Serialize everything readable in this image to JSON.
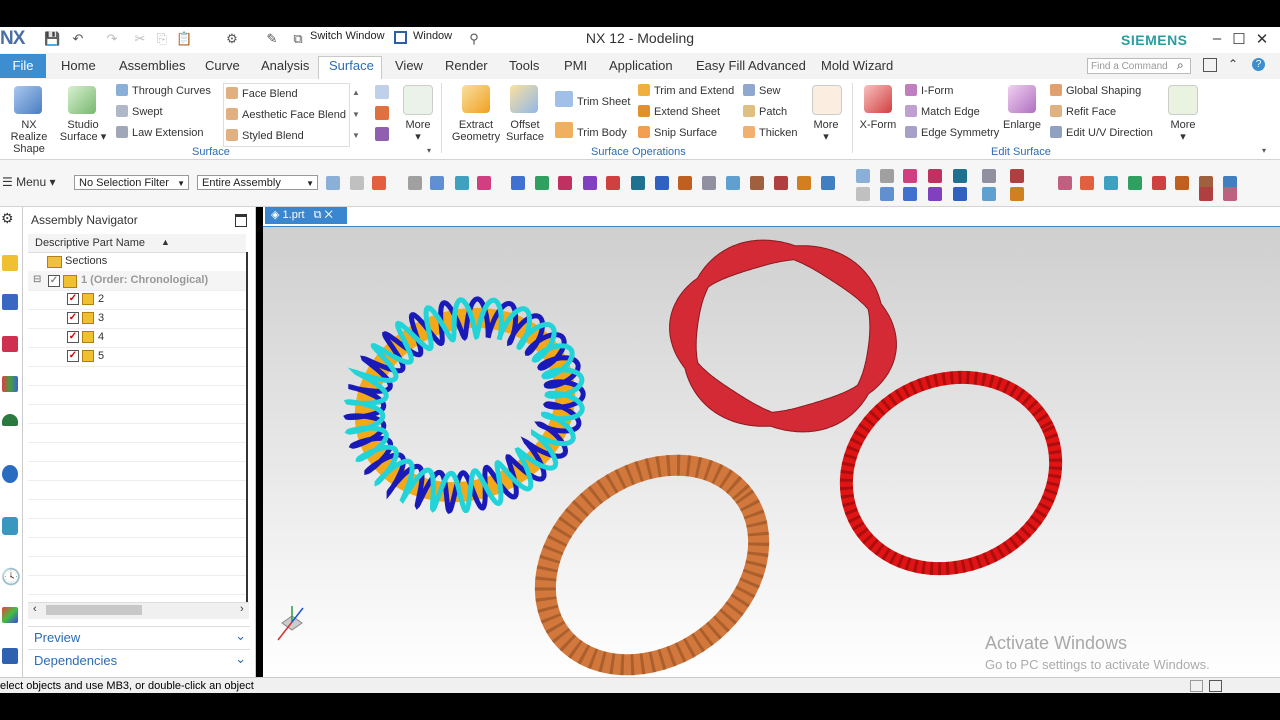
{
  "window": {
    "title": "NX 12 - Modeling",
    "logo": "NX",
    "brand": "SIEMENS",
    "switch_window": "Switch Window",
    "window_menu": "Window",
    "min": "–",
    "max": "☐",
    "close": "✕"
  },
  "tabs": {
    "file": "File",
    "items": [
      "Home",
      "Assemblies",
      "Curve",
      "Analysis",
      "Surface",
      "View",
      "Render",
      "Tools",
      "PMI",
      "Application",
      "Easy Fill Advanced",
      "Mold Wizard"
    ],
    "active": "Surface",
    "find_placeholder": "Find a Command"
  },
  "ribbon": {
    "surface": {
      "nx_realize_1": "NX Realize",
      "nx_realize_2": "Shape",
      "studio_1": "Studio",
      "studio_2": "Surface",
      "through_curves": "Through Curves",
      "swept": "Swept",
      "law_extension": "Law Extension",
      "face_blend": "Face Blend",
      "aesthetic_face_blend": "Aesthetic Face Blend",
      "styled_blend": "Styled Blend",
      "more": "More",
      "group_label": "Surface"
    },
    "surface_ops": {
      "extract_1": "Extract",
      "extract_2": "Geometry",
      "offset_1": "Offset",
      "offset_2": "Surface",
      "trim_sheet": "Trim Sheet",
      "trim_body": "Trim Body",
      "trim_and_extend": "Trim and Extend",
      "extend_sheet": "Extend Sheet",
      "snip_surface": "Snip Surface",
      "sew": "Sew",
      "patch": "Patch",
      "thicken": "Thicken",
      "more": "More",
      "group_label": "Surface Operations"
    },
    "edit_surface": {
      "xform": "X-Form",
      "iform": "I-Form",
      "match_edge": "Match Edge",
      "edge_symmetry": "Edge Symmetry",
      "enlarge": "Enlarge",
      "global_shaping": "Global Shaping",
      "refit_face": "Refit Face",
      "edit_uv": "Edit U/V Direction",
      "more": "More",
      "group_label": "Edit Surface"
    }
  },
  "toolbar": {
    "menu": "Menu",
    "selection_filter": "No Selection Filter",
    "assembly_scope": "Entire Assembly"
  },
  "navigator": {
    "title": "Assembly Navigator",
    "column": "Descriptive Part Name",
    "rows": [
      {
        "label": "Sections"
      },
      {
        "label": "1 (Order: Chronological)"
      },
      {
        "label": "2"
      },
      {
        "label": "3"
      },
      {
        "label": "4"
      },
      {
        "label": "5"
      }
    ],
    "preview": "Preview",
    "dependencies": "Dependencies"
  },
  "viewport": {
    "tab_label": "1.prt",
    "watermark_title": "Activate Windows",
    "watermark_sub": "Go to PC settings to activate Windows."
  },
  "status": {
    "message": "elect objects and use MB3, or double-click an object"
  },
  "colors": {
    "accent": "#3c8ed0",
    "brand": "#2a9d9f",
    "group_label": "#2b6cb5",
    "coil_blue": "#1a1ab8",
    "coil_cyan": "#22d4d8",
    "torus_orange": "#f2a818",
    "ribbon_red": "#d42a35",
    "rope_red": "#e01414",
    "rope_copper": "#d2783c"
  }
}
